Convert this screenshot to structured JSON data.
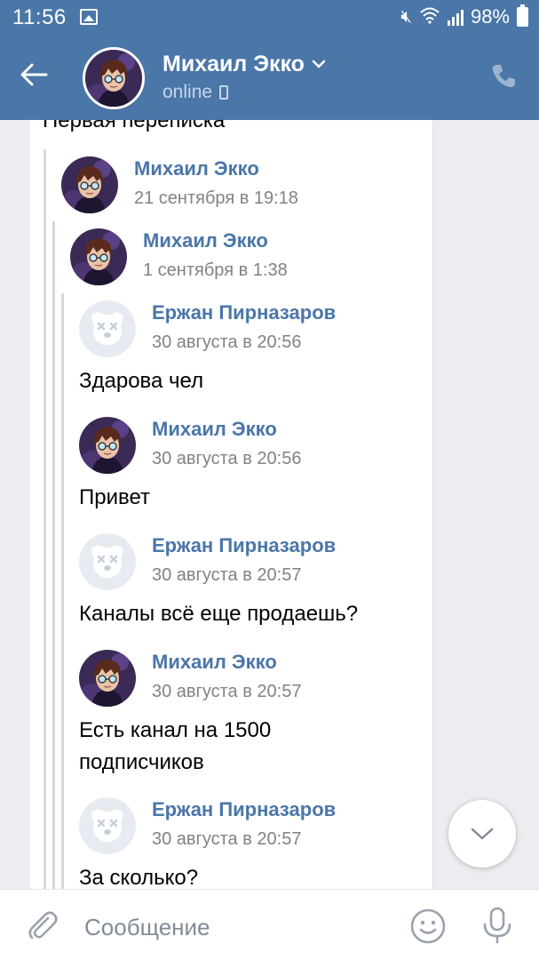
{
  "statusbar": {
    "time": "11:56",
    "battery": "98%"
  },
  "header": {
    "name": "Михаил Экко",
    "status": "online"
  },
  "chat": {
    "message_title": "Первая переписка",
    "forwards": [
      {
        "author": "Михаил Экко",
        "date": "21 сентября в 19:18"
      },
      {
        "author": "Михаил Экко",
        "date": "1 сентября в 1:38"
      }
    ],
    "messages": [
      {
        "author": "Ержан Пирназаров",
        "date": "30 августа в 20:56",
        "text": "Здарова чел"
      },
      {
        "author": "Михаил Экко",
        "date": "30 августа в 20:56",
        "text": "Привет"
      },
      {
        "author": "Ержан Пирназаров",
        "date": "30 августа в 20:57",
        "text": "Каналы всё еще продаешь?"
      },
      {
        "author": "Михаил Экко",
        "date": "30 августа в 20:57",
        "text_lines": [
          "Есть канал на 1500",
          "подписчиков"
        ]
      },
      {
        "author": "Ержан Пирназаров",
        "date": "30 августа в 20:57",
        "text": "За сколько?"
      }
    ]
  },
  "input": {
    "placeholder": "Сообщение"
  },
  "icons": {
    "back": "arrow-left-icon",
    "call": "phone-icon",
    "attach": "paperclip-icon",
    "emoji": "smile-icon",
    "mic": "microphone-icon",
    "scroll": "chevron-down-icon"
  },
  "colors": {
    "brand": "#4a76a8",
    "link": "#4a76a8",
    "meta": "#828282",
    "background": "#ebedf0"
  }
}
